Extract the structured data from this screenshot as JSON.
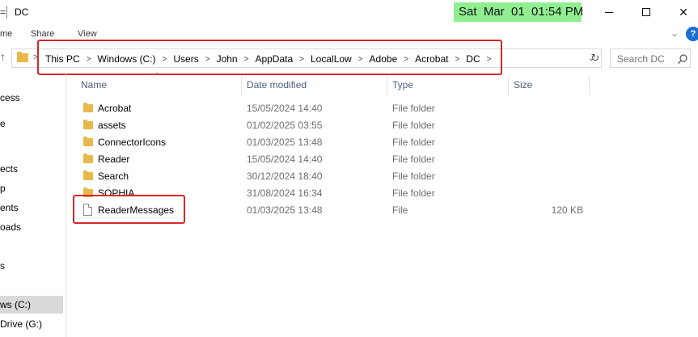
{
  "window": {
    "title_prefix": "=",
    "title": "DC",
    "clock": "Sat  Mar  01  01:54 PM",
    "minimize_glyph": "",
    "maximize_glyph": "",
    "close_glyph": "✕"
  },
  "ribbon": {
    "tabs": [
      "me",
      "Share",
      "View"
    ],
    "expand_glyph": "⌄",
    "help_glyph": "?"
  },
  "address": {
    "up_glyph": "↑",
    "path": [
      "This PC",
      "Windows (C:)",
      "Users",
      "John",
      "AppData",
      "LocalLow",
      "Adobe",
      "Acrobat",
      "DC"
    ],
    "separator": ">",
    "dropdown_glyph": "⌄",
    "refresh_glyph": "↻"
  },
  "search": {
    "placeholder": "Search DC"
  },
  "nav_pane": {
    "items": [
      "cess",
      "e",
      "ects",
      "p",
      "ents",
      "oads",
      "s",
      "ws (C:)",
      "Drive (G:)"
    ]
  },
  "columns": {
    "name": "Name",
    "date": "Date modified",
    "type": "Type",
    "size": "Size",
    "sort_glyph": "^"
  },
  "files": [
    {
      "name": "Acrobat",
      "date": "15/05/2024 14:40",
      "type": "File folder",
      "size": "",
      "icon": "folder-icon"
    },
    {
      "name": "assets",
      "date": "01/02/2025 03:55",
      "type": "File folder",
      "size": "",
      "icon": "folder-icon"
    },
    {
      "name": "ConnectorIcons",
      "date": "01/03/2025 13:48",
      "type": "File folder",
      "size": "",
      "icon": "folder-icon"
    },
    {
      "name": "Reader",
      "date": "15/05/2024 14:40",
      "type": "File folder",
      "size": "",
      "icon": "folder-icon"
    },
    {
      "name": "Search",
      "date": "30/12/2024 18:40",
      "type": "File folder",
      "size": "",
      "icon": "folder-icon"
    },
    {
      "name": "SOPHIA",
      "date": "31/08/2024 16:34",
      "type": "File folder",
      "size": "",
      "icon": "folder-icon"
    },
    {
      "name": "ReaderMessages",
      "date": "01/03/2025 13:48",
      "type": "File",
      "size": "120 KB",
      "icon": "file-icon"
    }
  ],
  "colors": {
    "clock_bg": "#90ee90",
    "highlight": "#d6282b",
    "folder": "#e8b84a",
    "header_text": "#4c607a"
  }
}
